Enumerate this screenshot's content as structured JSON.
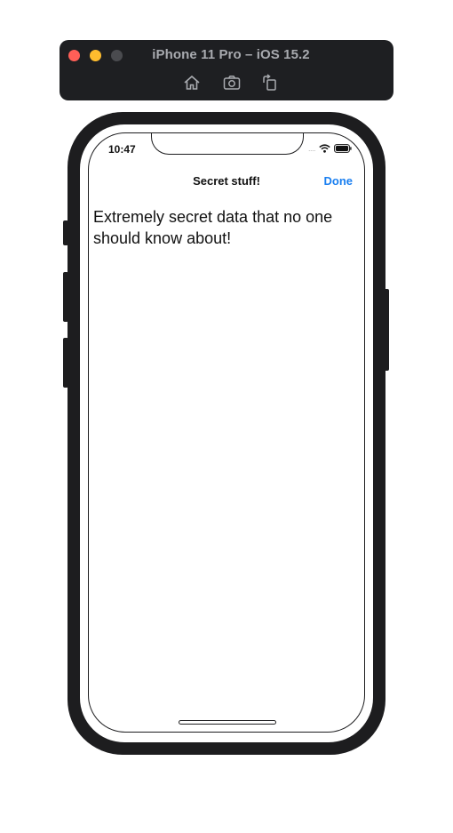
{
  "simulator": {
    "title": "iPhone 11 Pro – iOS 15.2",
    "toolbar": [
      {
        "name": "home",
        "icon": "home-icon"
      },
      {
        "name": "screenshot",
        "icon": "camera-icon"
      },
      {
        "name": "rotate",
        "icon": "rotate-icon"
      }
    ]
  },
  "status_bar": {
    "time": "10:47",
    "signal": "....",
    "icons": [
      "wifi-icon",
      "battery-icon"
    ]
  },
  "nav_bar": {
    "title": "Secret stuff!",
    "done_label": "Done",
    "accent_color": "#1a7ff0"
  },
  "content": {
    "text": "Extremely secret data that no one should know about!"
  }
}
